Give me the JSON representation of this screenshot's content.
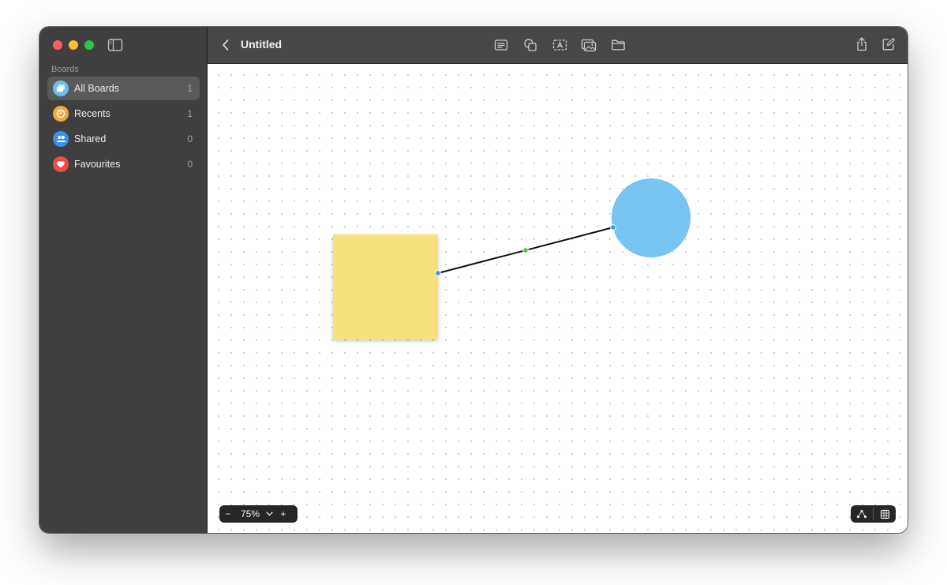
{
  "window": {
    "title": "Untitled"
  },
  "sidebar": {
    "section_label": "Boards",
    "items": [
      {
        "label": "All Boards",
        "count": "1",
        "icon": "boards-icon",
        "color": "#6cc0ef",
        "selected": true
      },
      {
        "label": "Recents",
        "count": "1",
        "icon": "clock-icon",
        "color": "#f2a93b",
        "selected": false
      },
      {
        "label": "Shared",
        "count": "0",
        "icon": "people-icon",
        "color": "#3d8ef0",
        "selected": false
      },
      {
        "label": "Favourites",
        "count": "0",
        "icon": "heart-icon",
        "color": "#ec4c48",
        "selected": false
      }
    ]
  },
  "toolbar": {
    "tools": [
      "text-box-icon",
      "shapes-icon",
      "text-icon",
      "media-icon",
      "folder-icon"
    ],
    "right": [
      "share-icon",
      "compose-icon"
    ]
  },
  "canvas": {
    "sticky_color": "#f9e07e",
    "circle_color": "#77c3f1",
    "connector_color": "#111111",
    "handle_color": "#3a9be0",
    "midpoint_color": "#58c04a"
  },
  "zoom": {
    "value": "75%",
    "minus": "−",
    "plus": "+"
  }
}
